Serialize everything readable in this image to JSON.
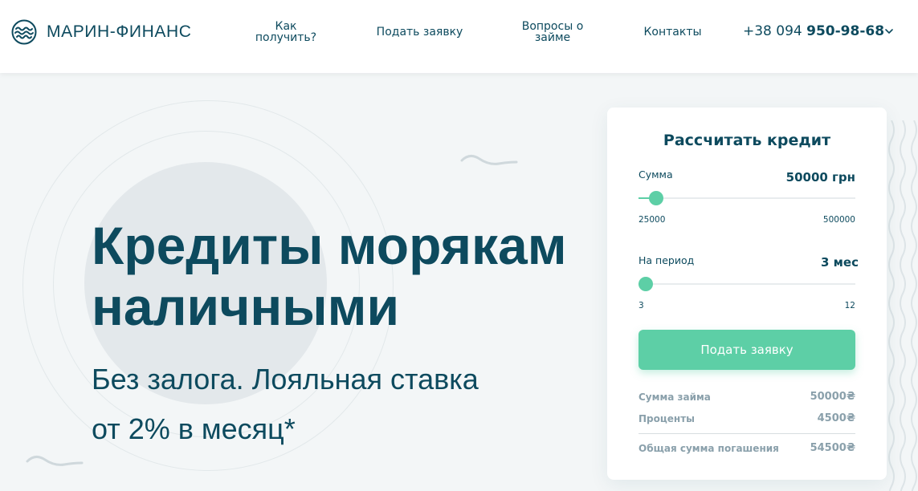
{
  "header": {
    "logo_text": "МАРИН-ФИНАНС",
    "nav": [
      {
        "line1": "Как",
        "line2": "получить?"
      },
      {
        "line1": "Подать заявку"
      },
      {
        "line1": "Вопросы о",
        "line2": "займе"
      },
      {
        "line1": "Контакты"
      }
    ],
    "phone_prefix": "+38 094",
    "phone_number": "950-98-68"
  },
  "hero": {
    "title_line1": "Кредиты морякам",
    "title_line2": "наличными",
    "subtitle_line1": "Без залога. Лояльная ставка",
    "subtitle_line2": "от 2% в месяц*"
  },
  "calculator": {
    "title": "Рассчитать кредит",
    "sum": {
      "label": "Сумма",
      "value_text": "50000 грн",
      "value": 50000,
      "min": 25000,
      "max": 500000,
      "min_label": "25000",
      "max_label": "500000"
    },
    "period": {
      "label": "На период",
      "value_text": "3 мес",
      "value": 3,
      "min": 3,
      "max": 12,
      "min_label": "3",
      "max_label": "12"
    },
    "submit_label": "Подать заявку",
    "summary": [
      {
        "label": "Сумма займа",
        "value": "50000₴"
      },
      {
        "label": "Проценты",
        "value": "4500₴"
      },
      {
        "label": "Общая сумма погашения",
        "value": "54500₴"
      }
    ]
  },
  "colors": {
    "primary": "#0d4a5e",
    "accent": "#5dcfa6",
    "muted": "#8aa0ab"
  },
  "icons": {
    "logo": "waves-logo-icon",
    "phone_dropdown": "chevron-down-icon"
  }
}
